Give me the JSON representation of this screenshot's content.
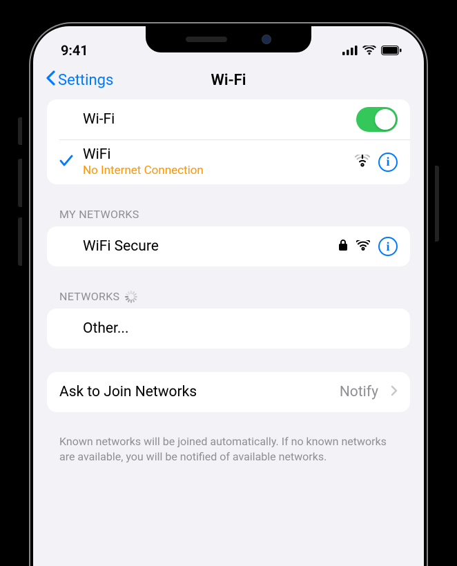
{
  "status": {
    "time": "9:41"
  },
  "nav": {
    "back_label": "Settings",
    "title": "Wi-Fi"
  },
  "wifi_toggle": {
    "label": "Wi-Fi",
    "enabled": true
  },
  "current_network": {
    "name": "WiFi",
    "status": "No Internet Connection"
  },
  "sections": {
    "my_networks": {
      "header": "My Networks",
      "items": [
        {
          "name": "WiFi Secure",
          "locked": true
        }
      ]
    },
    "networks": {
      "header": "Networks",
      "other_label": "Other..."
    }
  },
  "ask_join": {
    "label": "Ask to Join Networks",
    "value": "Notify"
  },
  "footer": "Known networks will be joined automatically. If no known networks are available, you will be notified of available networks."
}
